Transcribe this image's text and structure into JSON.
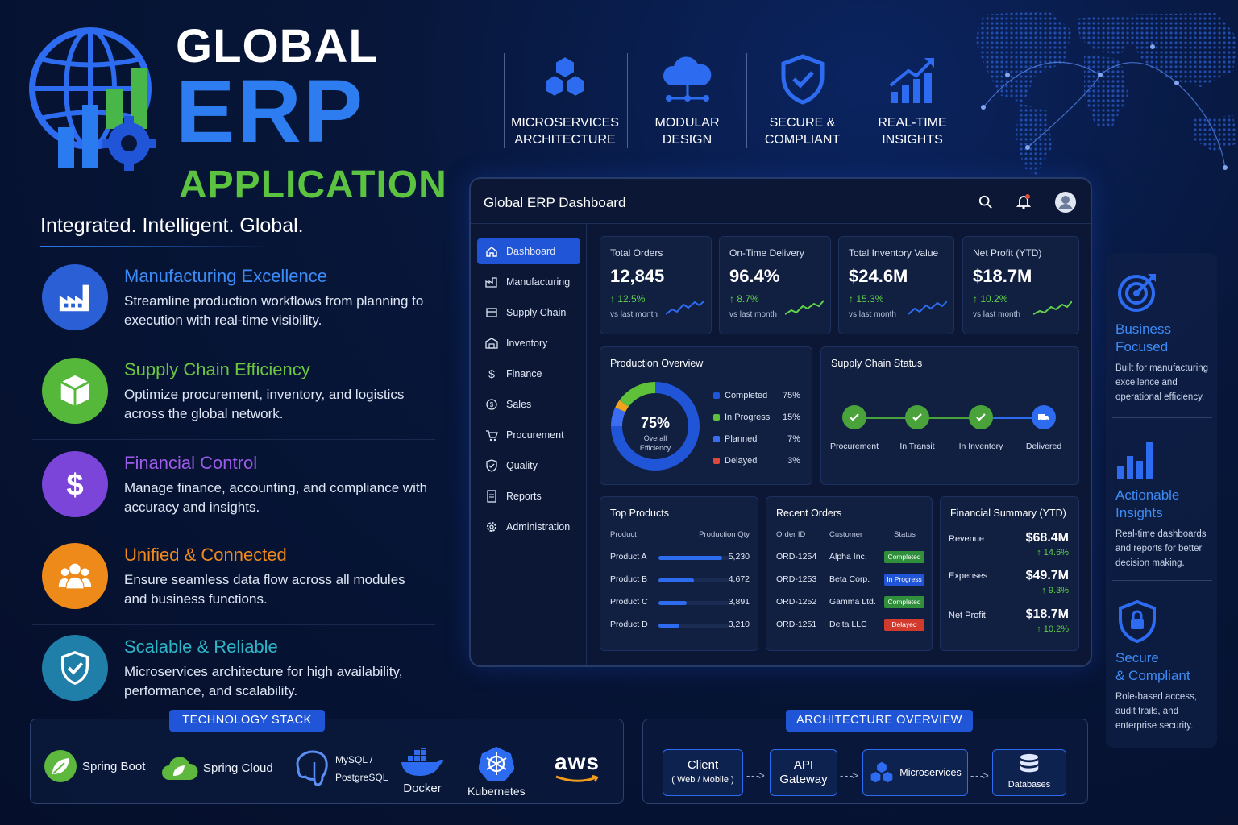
{
  "hero": {
    "title_1": "GLOBAL",
    "title_2": "ERP",
    "title_3": "APPLICATION",
    "tagline": "Integrated. Intelligent. Global."
  },
  "features": [
    {
      "title": "Manufacturing Excellence",
      "desc": "Streamline production workflows from planning to execution with real-time visibility.",
      "color": "#3d8bf5",
      "icon": "factory-icon"
    },
    {
      "title": "Supply Chain Efficiency",
      "desc": "Optimize procurement, inventory, and logistics across the global network.",
      "color": "#6cc63f",
      "icon": "box-icon"
    },
    {
      "title": "Financial Control",
      "desc": "Manage finance, accounting, and compliance with accuracy and insights.",
      "color": "#9b5ce8",
      "icon": "dollar-icon"
    },
    {
      "title": "Unified & Connected",
      "desc": "Ensure seamless data flow across all modules and business functions.",
      "color": "#f08a1c",
      "icon": "people-icon"
    },
    {
      "title": "Scalable & Reliable",
      "desc": "Microservices architecture for high availability, performance, and scalability.",
      "color": "#2fb5c8",
      "icon": "shield-check-icon"
    }
  ],
  "pillars": [
    {
      "line1": "MICROSERVICES",
      "line2": "ARCHITECTURE",
      "icon": "hexagons-icon"
    },
    {
      "line1": "MODULAR",
      "line2": "DESIGN",
      "icon": "cloud-nodes-icon"
    },
    {
      "line1": "SECURE &",
      "line2": "COMPLIANT",
      "icon": "shield-check-icon"
    },
    {
      "line1": "REAL-TIME",
      "line2": "INSIGHTS",
      "icon": "growth-chart-icon"
    }
  ],
  "dashboard": {
    "title": "Global ERP Dashboard",
    "nav": [
      "Dashboard",
      "Manufacturing",
      "Supply Chain",
      "Inventory",
      "Finance",
      "Sales",
      "Procurement",
      "Quality",
      "Reports",
      "Administration"
    ],
    "kpis": [
      {
        "label": "Total Orders",
        "value": "12,845",
        "change": "12.5%",
        "sub": "vs last month",
        "spark_color": "#2d6cf0"
      },
      {
        "label": "On-Time Delivery",
        "value": "96.4%",
        "change": "8.7%",
        "sub": "vs last month",
        "spark_color": "#5fd24a"
      },
      {
        "label": "Total Inventory Value",
        "value": "$24.6M",
        "change": "15.3%",
        "sub": "vs last month",
        "spark_color": "#2d6cf0"
      },
      {
        "label": "Net Profit (YTD)",
        "value": "$18.7M",
        "change": "10.2%",
        "sub": "vs last month",
        "spark_color": "#5fd24a"
      }
    ],
    "production": {
      "title": "Production Overview",
      "center_value": "75%",
      "center_label_1": "Overall",
      "center_label_2": "Efficiency",
      "legend": [
        {
          "label": "Completed",
          "value": "75%",
          "pct": 75,
          "color": "#1f55d6"
        },
        {
          "label": "In Progress",
          "value": "15%",
          "pct": 15,
          "color": "#5fc13a"
        },
        {
          "label": "Planned",
          "value": "7%",
          "pct": 7,
          "color": "#3a6df0"
        },
        {
          "label": "Delayed",
          "value": "3%",
          "pct": 3,
          "color": "#e0493a"
        }
      ]
    },
    "supply": {
      "title": "Supply Chain Status",
      "steps": [
        "Procurement",
        "In Transit",
        "In Inventory",
        "Delivered"
      ]
    },
    "top_products": {
      "title": "Top Products",
      "col_product": "Product",
      "col_qty": "Production Qty",
      "rows": [
        {
          "name": "Product A",
          "qty": "5,230",
          "frac": 0.9
        },
        {
          "name": "Product B",
          "qty": "4,672",
          "frac": 0.5
        },
        {
          "name": "Product C",
          "qty": "3,891",
          "frac": 0.4
        },
        {
          "name": "Product D",
          "qty": "3,210",
          "frac": 0.3
        }
      ]
    },
    "recent_orders": {
      "title": "Recent Orders",
      "col_id": "Order ID",
      "col_customer": "Customer",
      "col_status": "Status",
      "rows": [
        {
          "id": "ORD-1254",
          "customer": "Alpha Inc.",
          "status": "Completed",
          "color": "#2f8f3a"
        },
        {
          "id": "ORD-1253",
          "customer": "Beta Corp.",
          "status": "In Progress",
          "color": "#1f55d6"
        },
        {
          "id": "ORD-1252",
          "customer": "Gamma Ltd.",
          "status": "Completed",
          "color": "#2f8f3a"
        },
        {
          "id": "ORD-1251",
          "customer": "Delta LLC",
          "status": "Delayed",
          "color": "#d23a2e"
        }
      ]
    },
    "financial": {
      "title": "Financial Summary (YTD)",
      "rows": [
        {
          "label": "Revenue",
          "value": "$68.4M",
          "change": "14.6%"
        },
        {
          "label": "Expenses",
          "value": "$49.7M",
          "change": "9.3%"
        },
        {
          "label": "Net Profit",
          "value": "$18.7M",
          "change": "10.2%"
        }
      ]
    }
  },
  "right_panel": [
    {
      "title_1": "Business",
      "title_2": "Focused",
      "desc": "Built for manufacturing excellence and operational efficiency.",
      "icon": "target-icon"
    },
    {
      "title_1": "Actionable",
      "title_2": "Insights",
      "desc": "Real-time dashboards and reports for better decision making.",
      "icon": "bar-chart-icon"
    },
    {
      "title_1": "Secure",
      "title_2": "& Compliant",
      "desc": "Role-based access, audit trails, and enterprise security.",
      "icon": "shield-lock-icon"
    }
  ],
  "tech_stack": {
    "heading": "TECHNOLOGY STACK",
    "items": [
      "Spring Boot",
      "Spring Cloud",
      "MySQL /",
      "PostgreSQL",
      "Docker",
      "Kubernetes",
      "aws"
    ]
  },
  "architecture": {
    "heading": "ARCHITECTURE OVERVIEW",
    "client": "Client",
    "client_sub": "( Web / Mobile )",
    "api_1": "API",
    "api_2": "Gateway",
    "micro": "Microservices",
    "db": "Databases",
    "arrow": "- - ->"
  }
}
